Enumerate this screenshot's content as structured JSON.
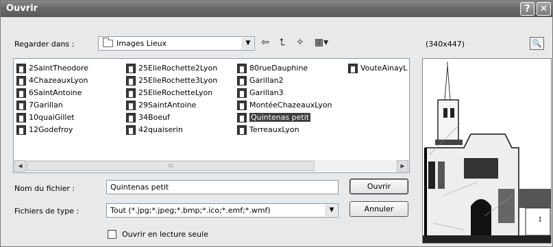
{
  "window": {
    "title": "Ouvrir",
    "help_glyph": "?",
    "close_glyph": "✕"
  },
  "lookin": {
    "label": "Regarder dans :",
    "value": "Images Lieux",
    "icons": [
      "back-arrow-icon",
      "up-folder-icon",
      "new-folder-icon",
      "view-menu-icon"
    ]
  },
  "preview": {
    "dimensions": "(340x447)",
    "button_icon": "preview-zoom-icon"
  },
  "files": {
    "columns": [
      [
        "2SaintTheodore",
        "4ChazeauxLyon",
        "6SaintAntoine",
        "7Garillan",
        "10quaiGillet",
        "12Godefroy"
      ],
      [
        "25ElieRochette2Lyon",
        "25ElieRochette3Lyon",
        "25ElieRochetteLyon",
        "29SaintAntoine",
        "34Boeuf",
        "42quaiserin"
      ],
      [
        "80rueDauphine",
        "Garillan2",
        "Garillan3",
        "MontéeChazeauxLyon",
        "Quintenas petit",
        "TerreauxLyon"
      ],
      [
        "VouteAinayL"
      ]
    ],
    "selected": "Quintenas petit",
    "scroll_thumb_mark": "III"
  },
  "filename": {
    "label": "Nom du fichier :",
    "value": "Quintenas petit"
  },
  "filetype": {
    "label": "Fichiers de type :",
    "value": "Tout (*.jpg;*.jpeg;*.bmp;*.ico;*.emf;*.wmf)"
  },
  "buttons": {
    "open": "Ouvrir",
    "cancel": "Annuler"
  },
  "readonly": {
    "label": "Ouvrir en lecture seule",
    "checked": false
  }
}
